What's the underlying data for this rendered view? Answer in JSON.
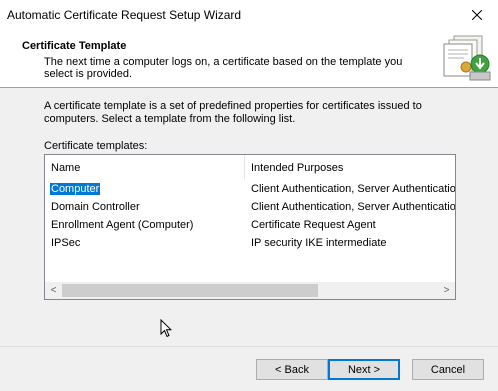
{
  "window": {
    "title": "Automatic Certificate Request Setup Wizard",
    "close_glyph": "✕"
  },
  "header": {
    "title": "Certificate Template",
    "description": "The next time a computer logs on, a certificate based on the template you select is provided.",
    "icon": "certificate-wizard-icon"
  },
  "content": {
    "intro": "A certificate template is a set of predefined properties for certificates issued to computers. Select a template from the following list.",
    "list_label": "Certificate templates:",
    "columns": [
      "Name",
      "Intended Purposes"
    ],
    "rows": [
      {
        "name": "Computer",
        "purposes": "Client Authentication, Server Authentication",
        "selected": true
      },
      {
        "name": "Domain Controller",
        "purposes": "Client Authentication, Server Authentication",
        "selected": false
      },
      {
        "name": "Enrollment Agent (Computer)",
        "purposes": "Certificate Request Agent",
        "selected": false
      },
      {
        "name": "IPSec",
        "purposes": "IP security IKE intermediate",
        "selected": false
      }
    ],
    "scroll_left_glyph": "<",
    "scroll_right_glyph": ">"
  },
  "buttons": {
    "back": "< Back",
    "next": "Next >",
    "cancel": "Cancel"
  },
  "colors": {
    "selection": "#0078d7",
    "panel": "#f0f0f0"
  }
}
